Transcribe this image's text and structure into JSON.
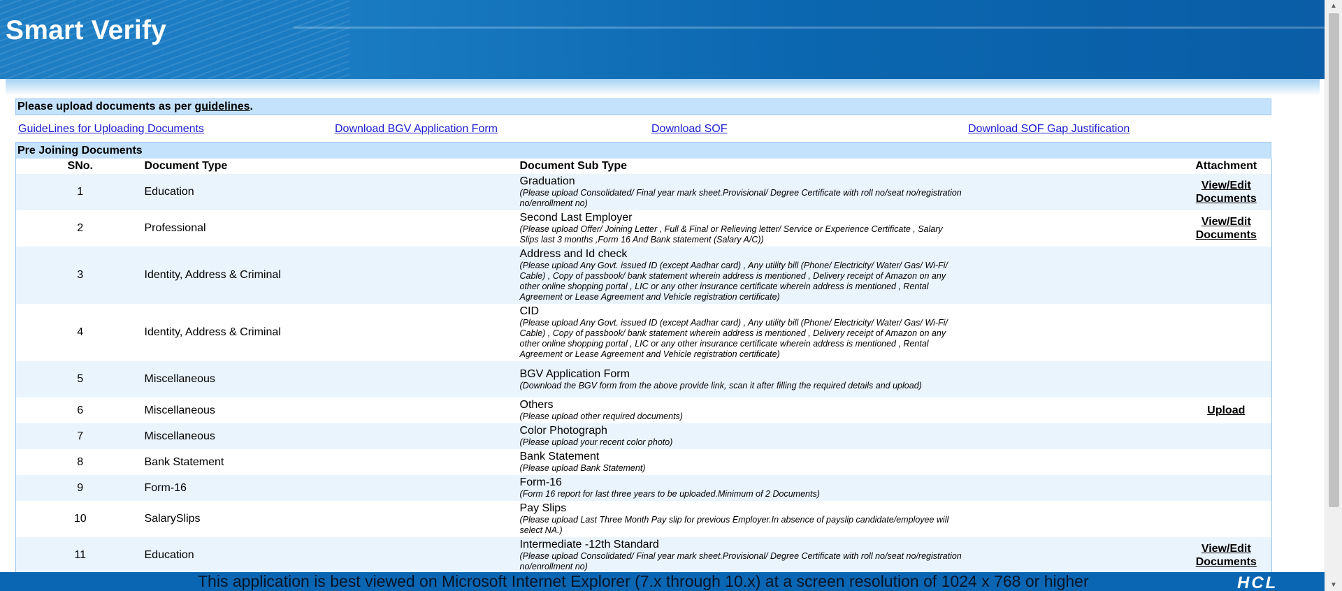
{
  "header": {
    "title": "Smart Verify"
  },
  "notice": {
    "prefix": "Please upload documents as per ",
    "link": "guidelines",
    "suffix": "."
  },
  "links": [
    "GuideLines for Uploading Documents",
    "Download BGV Application Form",
    "Download SOF",
    "Download SOF Gap Justification"
  ],
  "section": {
    "title": "Pre Joining Documents"
  },
  "table": {
    "headers": {
      "sno": "SNo.",
      "type": "Document Type",
      "subtype": "Document Sub Type",
      "attachment": "Attachment"
    },
    "rows": [
      {
        "sno": "1",
        "type": "Education",
        "sub_name": "Graduation",
        "sub_note": "(Please upload Consolidated/ Final year mark sheet.Provisional/ Degree Certificate with roll no/seat no/registration no/enrollment no)",
        "attachment": "View/Edit Documents"
      },
      {
        "sno": "2",
        "type": "Professional",
        "sub_name": "Second Last Employer",
        "sub_note": "(Please upload Offer/ Joining Letter , Full & Final or Relieving letter/ Service or Experience Certificate , Salary Slips last 3 months ,Form 16 And Bank statement (Salary A/C))",
        "attachment": "View/Edit Documents"
      },
      {
        "sno": "3",
        "type": "Identity, Address & Criminal",
        "sub_name": "Address and Id check",
        "sub_note": "(Please upload Any Govt. issued ID (except Aadhar card) , Any utility bill (Phone/ Electricity/ Water/ Gas/ Wi-Fi/ Cable) , Copy of passbook/ bank statement wherein address is mentioned , Delivery receipt of Amazon on any other online shopping portal , LIC or any other insurance certificate wherein address is mentioned , Rental Agreement or Lease Agreement and Vehicle registration certificate)",
        "attachment": ""
      },
      {
        "sno": "4",
        "type": "Identity, Address & Criminal",
        "sub_name": "CID",
        "sub_note": "(Please upload Any Govt. issued ID (except Aadhar card) , Any utility bill (Phone/ Electricity/ Water/ Gas/ Wi-Fi/ Cable) , Copy of passbook/ bank statement wherein address is mentioned , Delivery receipt of Amazon on any other online shopping portal , LIC or any other insurance certificate wherein address is mentioned , Rental Agreement or Lease Agreement and Vehicle registration certificate)",
        "attachment": ""
      },
      {
        "sno": "5",
        "type": "Miscellaneous",
        "sub_name": "BGV Application Form",
        "sub_note": "(Download the BGV form from the above provide link, scan it after filling the required details and upload)",
        "attachment": ""
      },
      {
        "sno": "6",
        "type": "Miscellaneous",
        "sub_name": "Others",
        "sub_note": "(Please upload other required documents)",
        "attachment": "Upload"
      },
      {
        "sno": "7",
        "type": "Miscellaneous",
        "sub_name": "Color Photograph",
        "sub_note": "(Please upload your recent color photo)",
        "attachment": ""
      },
      {
        "sno": "8",
        "type": "Bank Statement",
        "sub_name": "Bank Statement",
        "sub_note": "(Please upload Bank Statement)",
        "attachment": ""
      },
      {
        "sno": "9",
        "type": "Form-16",
        "sub_name": "Form-16",
        "sub_note": "(Form 16 report for last three years to be uploaded.Minimum of 2 Documents)",
        "attachment": ""
      },
      {
        "sno": "10",
        "type": "SalarySlips",
        "sub_name": "Pay Slips",
        "sub_note": "(Please upload Last Three Month Pay slip for previous Employer.In absence of payslip candidate/employee will select NA.)",
        "attachment": ""
      },
      {
        "sno": "11",
        "type": "Education",
        "sub_name": "Intermediate -12th Standard",
        "sub_note": "(Please upload Consolidated/ Final year mark sheet.Provisional/ Degree Certificate with roll no/seat no/registration no/enrollment no)",
        "attachment": "View/Edit Documents"
      }
    ]
  },
  "footer": {
    "text": "This application is best viewed on Microsoft Internet Explorer (7.x through 10.x) at a screen resolution of 1024 x 768 or higher",
    "logo": "HCL"
  },
  "colors": {
    "header_blue": "#0b67b0",
    "row_alt": "#eaf4fd",
    "link_blue": "#1b1bcf"
  }
}
